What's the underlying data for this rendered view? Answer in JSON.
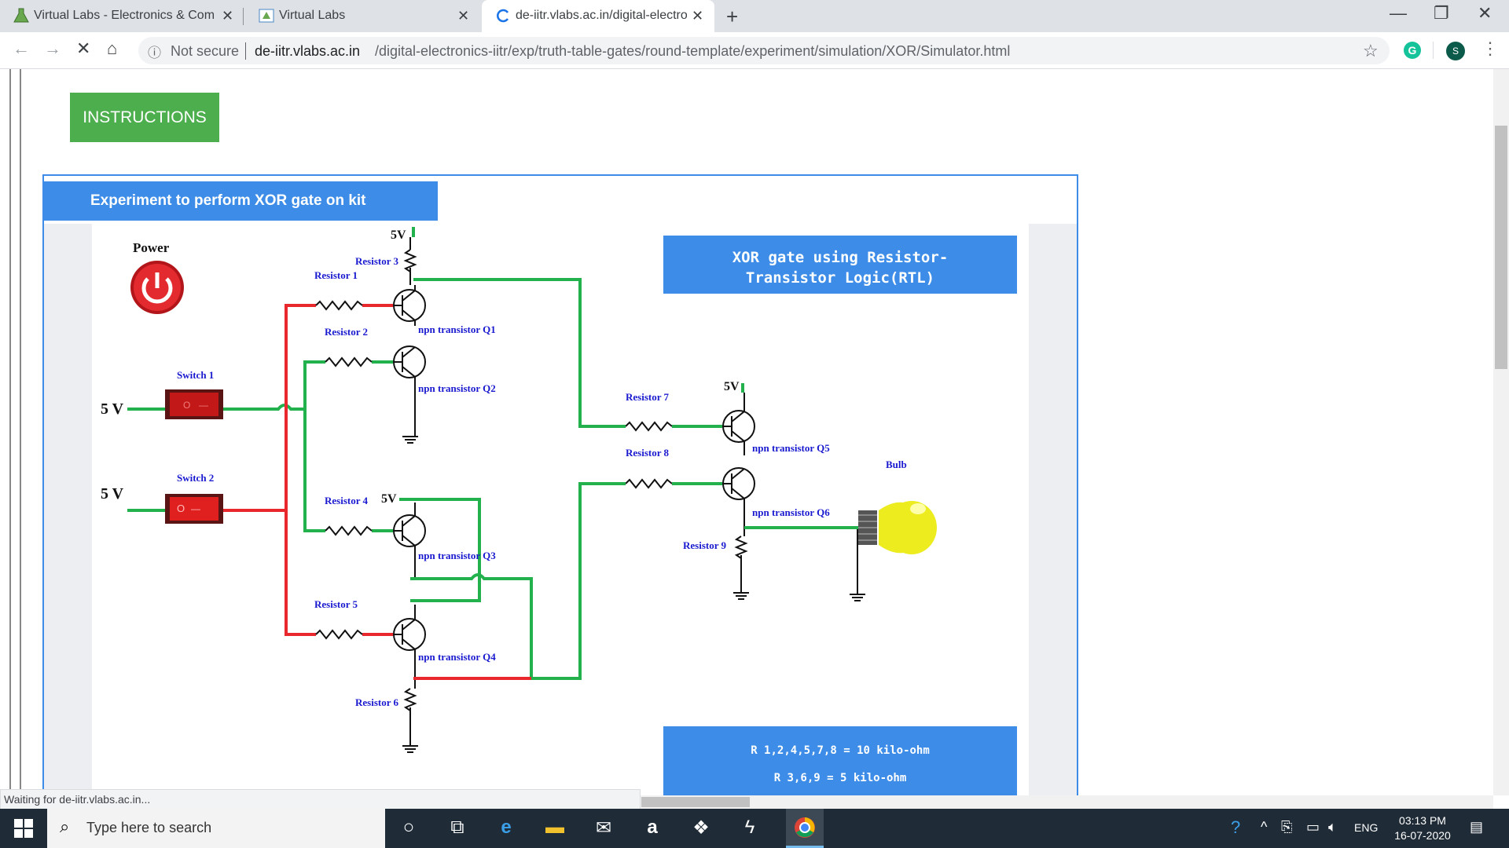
{
  "tabs": [
    {
      "title": "Virtual Labs - Electronics & Com",
      "active": false
    },
    {
      "title": "Virtual Labs",
      "active": false
    },
    {
      "title": "de-iitr.vlabs.ac.in/digital-electron",
      "active": true
    }
  ],
  "address_bar": {
    "security": "Not secure",
    "host": "de-iitr.vlabs.ac.in",
    "path": "/digital-electronics-iitr/exp/truth-table-gates/round-template/experiment/simulation/XOR/Simulator.html",
    "profile_initial": "S"
  },
  "page": {
    "instructions_label": "INSTRUCTIONS",
    "experiment_title": "Experiment to perform XOR gate on kit",
    "circuit_title_line1": "XOR gate using Resistor-",
    "circuit_title_line2": "Transistor Logic(RTL)",
    "resistance_line1": "R 1,2,4,5,7,8 = 10 kilo-ohm",
    "resistance_line2": "R 3,6,9 = 5 kilo-ohm",
    "power_label": "Power",
    "switch1_label": "Switch 1",
    "switch2_label": "Switch 2",
    "voltage_5v": "5 V",
    "voltage_5v_compact": "5V",
    "bulb_label": "Bulb",
    "resistors": {
      "r1": "Resistor 1",
      "r2": "Resistor 2",
      "r3": "Resistor 3",
      "r4": "Resistor 4",
      "r5": "Resistor 5",
      "r6": "Resistor 6",
      "r7": "Resistor 7",
      "r8": "Resistor 8",
      "r9": "Resistor 9"
    },
    "transistors": {
      "q1": "npn transistor Q1",
      "q2": "npn transistor Q2",
      "q3": "npn transistor Q3",
      "q4": "npn transistor Q4",
      "q5": "npn transistor Q5",
      "q6": "npn transistor Q6"
    },
    "switch1_state": "off",
    "switch2_state": "on"
  },
  "status_text": "Waiting for de-iitr.vlabs.ac.in...",
  "taskbar": {
    "search_placeholder": "Type here to search",
    "language": "ENG",
    "time": "03:13 PM",
    "date": "16-07-2020"
  },
  "colors": {
    "wire_green": "#22b14c",
    "wire_red": "#e8282c",
    "label_blue": "#1a1ad0",
    "header_blue": "#3c8ce8",
    "instructions_green": "#4cae4c"
  }
}
